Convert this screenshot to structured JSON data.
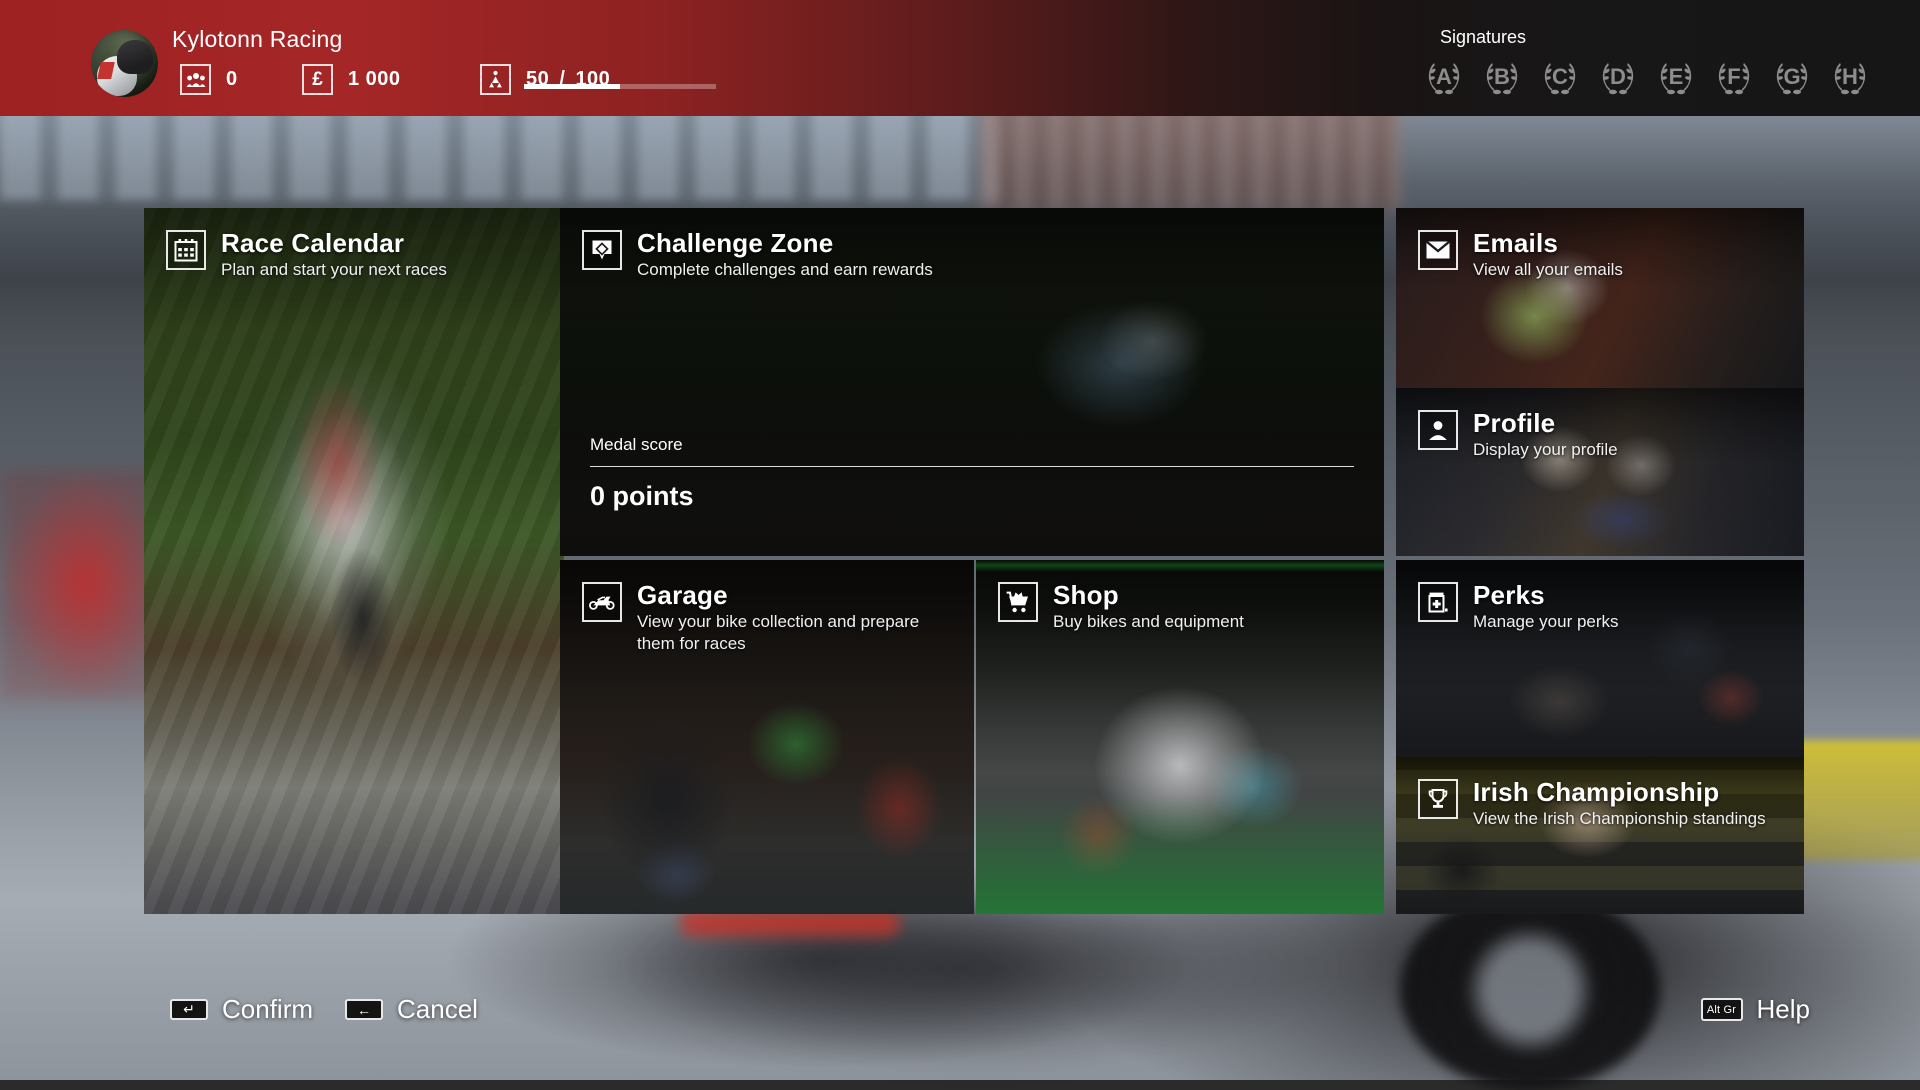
{
  "topbar": {
    "player_name": "Kylotonn Racing",
    "avatar_name": "rider-avatar",
    "stats": [
      {
        "icon": "fans-icon",
        "label": "fans",
        "value": "0"
      },
      {
        "icon": "money-icon",
        "label": "money",
        "value": "1 000"
      }
    ],
    "level": {
      "icon": "level-icon",
      "current": "50",
      "separator": "/",
      "max": "100",
      "progress_percent": 50
    },
    "signatures": {
      "label": "Signatures",
      "badges": [
        "A",
        "B",
        "C",
        "D",
        "E",
        "F",
        "G",
        "H"
      ]
    },
    "accent_color": "#a52626"
  },
  "tiles": {
    "race_calendar": {
      "title": "Race Calendar",
      "subtitle": "Plan and start your next races",
      "icon": "calendar-icon"
    },
    "challenge_zone": {
      "title": "Challenge Zone",
      "subtitle": "Complete challenges and earn rewards",
      "icon": "challenge-badge-icon",
      "medal_score_label": "Medal score",
      "medal_score_value": "0 points"
    },
    "emails": {
      "title": "Emails",
      "subtitle": "View all your emails",
      "icon": "envelope-icon"
    },
    "profile": {
      "title": "Profile",
      "subtitle": "Display your profile",
      "icon": "person-icon"
    },
    "garage": {
      "title": "Garage",
      "subtitle": "View your bike collection and prepare them for races",
      "icon": "motorcycle-icon"
    },
    "shop": {
      "title": "Shop",
      "subtitle": "Buy bikes and equipment",
      "icon": "shopping-cart-icon"
    },
    "perks": {
      "title": "Perks",
      "subtitle": "Manage your perks",
      "icon": "perk-bottle-icon"
    },
    "irish_championship": {
      "title": "Irish Championship",
      "subtitle": "View the Irish Championship standings",
      "icon": "trophy-icon"
    }
  },
  "footer": {
    "confirm": {
      "label": "Confirm",
      "key": "enter-key-icon"
    },
    "cancel": {
      "label": "Cancel",
      "key": "backspace-key-icon"
    },
    "help": {
      "label": "Help",
      "key": "Alt Gr"
    }
  }
}
